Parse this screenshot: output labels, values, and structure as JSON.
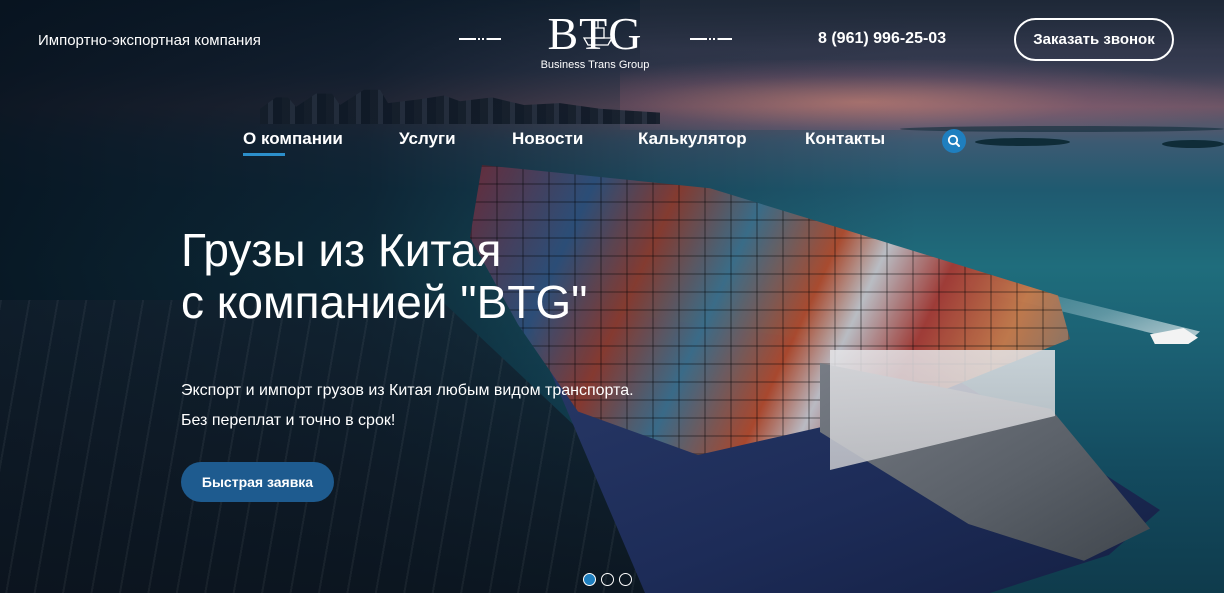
{
  "header": {
    "tagline": "Импортно-экспортная компания",
    "logo_mark": "BTG",
    "logo_sub": "Business Trans Group",
    "phone": "8 (961) 996-25-03",
    "callback_label": "Заказать звонок"
  },
  "nav": {
    "items": [
      {
        "label": "О компании",
        "active": true
      },
      {
        "label": "Услуги"
      },
      {
        "label": "Новости"
      },
      {
        "label": "Калькулятор"
      },
      {
        "label": "Контакты"
      }
    ],
    "search_icon": "search-icon"
  },
  "hero": {
    "headline_line1": "Грузы из Китая",
    "headline_line2": "с компанией \"BTG\"",
    "lead_line1": "Экспорт и импорт грузов из Китая любым видом транспорта.",
    "lead_line2": "Без переплат и точно в срок!",
    "cta_label": "Быстрая заявка"
  },
  "slider": {
    "count": 3,
    "active_index": 0
  },
  "colors": {
    "accent": "#1f7fbf",
    "cta": "#1e5b8f",
    "text": "#ffffff"
  }
}
